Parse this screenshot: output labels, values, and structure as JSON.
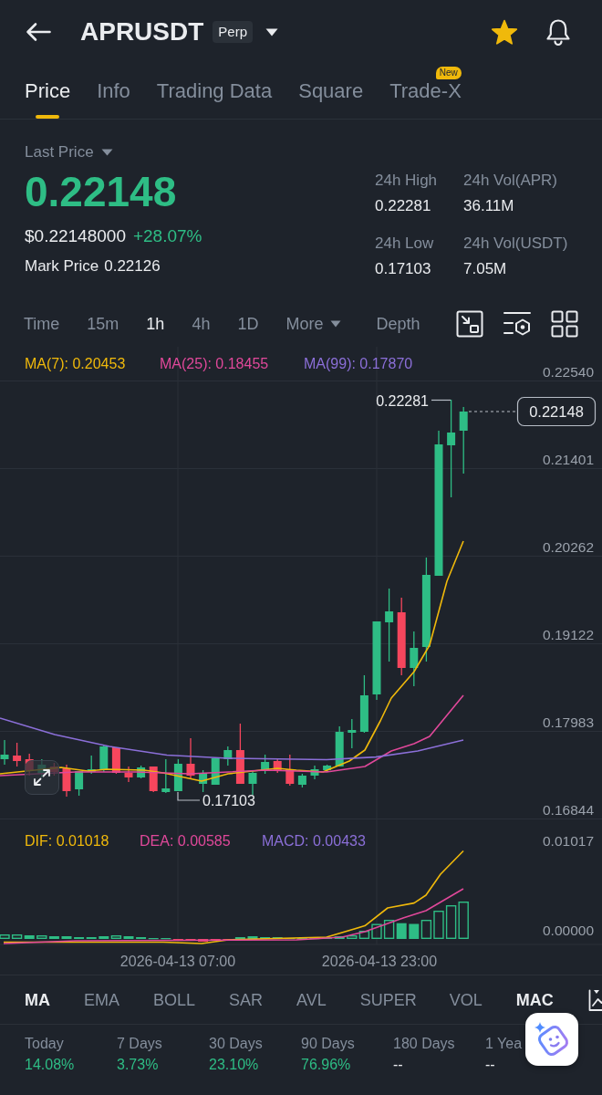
{
  "header": {
    "symbol": "APRUSDT",
    "contract_type": "Perp",
    "favorited": true
  },
  "tabs": [
    {
      "label": "Price",
      "selected": true
    },
    {
      "label": "Info",
      "selected": false
    },
    {
      "label": "Trading Data",
      "selected": false
    },
    {
      "label": "Square",
      "selected": false
    },
    {
      "label": "Trade-X",
      "selected": false,
      "badge": "New"
    }
  ],
  "summary": {
    "price_type": "Last Price",
    "last_price": "0.22148",
    "usd_price": "$0.22148000",
    "change": "+28.07%",
    "mark_label": "Mark Price",
    "mark_price": "0.22126",
    "stats": [
      {
        "label": "24h High",
        "value": "0.22281"
      },
      {
        "label": "24h Vol(APR)",
        "value": "36.11M"
      },
      {
        "label": "24h Low",
        "value": "0.17103"
      },
      {
        "label": "24h Vol(USDT)",
        "value": "7.05M"
      }
    ]
  },
  "intervals": [
    {
      "label": "Time",
      "kind": "interval",
      "selected": false
    },
    {
      "label": "15m",
      "kind": "interval",
      "selected": false
    },
    {
      "label": "1h",
      "kind": "interval",
      "selected": true
    },
    {
      "label": "4h",
      "kind": "interval",
      "selected": false
    },
    {
      "label": "1D",
      "kind": "interval",
      "selected": false
    },
    {
      "label": "More",
      "kind": "dropdown",
      "selected": false
    },
    {
      "label": "Depth",
      "kind": "view",
      "selected": false
    }
  ],
  "price_chart": {
    "legend": [
      {
        "label": "MA(7): 0.20453",
        "color": "#f0b90b"
      },
      {
        "label": "MA(25): 0.18455",
        "color": "#e0489a"
      },
      {
        "label": "MA(99): 0.17870",
        "color": "#8b6fd8"
      }
    ],
    "price_axis": [
      "0.22540",
      "0.21401",
      "0.20262",
      "0.19122",
      "0.17983",
      "0.16844"
    ],
    "high_label": "0.22281",
    "low_label": "0.17103",
    "current_price": "0.22148"
  },
  "macd_chart": {
    "legend": [
      {
        "label": "DIF: 0.01018",
        "color": "#f0b90b"
      },
      {
        "label": "DEA: 0.00585",
        "color": "#e0489a"
      },
      {
        "label": "MACD: 0.00433",
        "color": "#8b6fd8"
      }
    ],
    "value_axis": [
      "0.01017",
      "0.00000"
    ]
  },
  "time_axis": [
    "2026-04-13 07:00",
    "2026-04-13 23:00"
  ],
  "indicators": {
    "main": [
      {
        "label": "MA",
        "selected": true
      },
      {
        "label": "EMA",
        "selected": false
      },
      {
        "label": "BOLL",
        "selected": false
      },
      {
        "label": "SAR",
        "selected": false
      },
      {
        "label": "AVL",
        "selected": false
      },
      {
        "label": "SUPER",
        "selected": false
      }
    ],
    "sub": [
      {
        "label": "VOL",
        "selected": false
      },
      {
        "label": "MAC",
        "selected": true
      }
    ]
  },
  "performance": [
    {
      "period": "Today",
      "change": "14.08%",
      "color": "#2ebd85"
    },
    {
      "period": "7 Days",
      "change": "3.73%",
      "color": "#2ebd85"
    },
    {
      "period": "30 Days",
      "change": "23.10%",
      "color": "#2ebd85"
    },
    {
      "period": "90 Days",
      "change": "76.96%",
      "color": "#2ebd85"
    },
    {
      "period": "180 Days",
      "change": "--",
      "color": "#eaecef"
    },
    {
      "period": "1 Yea",
      "change": "--",
      "color": "#eaecef"
    }
  ]
}
